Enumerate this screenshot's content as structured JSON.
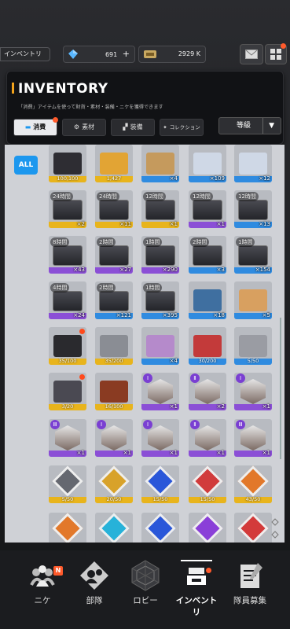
{
  "header": {
    "section_tag": "インベントリ",
    "gems": "691",
    "gems_plus": "+",
    "credits": "2929 K"
  },
  "panel": {
    "title": "INVENTORY",
    "subtitle": "「消費」アイテムを使って財貨・素材・装備・ニケを獲得できます",
    "tabs": [
      {
        "label": "消費",
        "icon": "consumable-icon"
      },
      {
        "label": "素材",
        "icon": "material-icon"
      },
      {
        "label": "装備",
        "icon": "equipment-icon"
      },
      {
        "label": "コレクション",
        "icon": "collection-icon"
      }
    ],
    "sort_label": "等級",
    "sort_arrow": "▼"
  },
  "filter": {
    "all_label": "ALL"
  },
  "colors": {
    "accent": "#f3a31c",
    "blue": "#1c97ee",
    "ssr": "#e8b41c",
    "sr": "#8b4fd6",
    "r": "#2f8be0"
  },
  "items": [
    {
      "label": "",
      "count": "100,100",
      "rarity": "ssr",
      "art": "dark-box",
      "row": 0,
      "col": 0
    },
    {
      "label": "",
      "count": "1,427",
      "rarity": "ssr",
      "art": "gold-box",
      "row": 0,
      "col": 1
    },
    {
      "label": "",
      "count": "4",
      "rarity": "r",
      "art": "cardboard-box",
      "row": 0,
      "col": 2
    },
    {
      "label": "",
      "count": "109",
      "rarity": "r",
      "art": "silver-box",
      "row": 0,
      "col": 4
    },
    {
      "label": "",
      "count": "12",
      "rarity": "r",
      "art": "silver-box",
      "row": 0,
      "col": 5
    },
    {
      "label": "24時間",
      "count": "2",
      "rarity": "ssr",
      "art": "crate",
      "row": 1,
      "col": 0
    },
    {
      "label": "24時間",
      "count": "11",
      "rarity": "ssr",
      "art": "crate",
      "row": 1,
      "col": 1
    },
    {
      "label": "12時間",
      "count": "1",
      "rarity": "ssr",
      "art": "crate",
      "row": 1,
      "col": 2
    },
    {
      "label": "12時間",
      "count": "1",
      "rarity": "sr",
      "art": "crate",
      "row": 1,
      "col": 4
    },
    {
      "label": "12時間",
      "count": "13",
      "rarity": "r",
      "art": "crate",
      "row": 1,
      "col": 5
    },
    {
      "label": "8時間",
      "count": "43",
      "rarity": "sr",
      "art": "crate",
      "row": 2,
      "col": 0
    },
    {
      "label": "2時間",
      "count": "27",
      "rarity": "sr",
      "art": "crate",
      "row": 2,
      "col": 1
    },
    {
      "label": "1時間",
      "count": "290",
      "rarity": "sr",
      "art": "crate",
      "row": 2,
      "col": 2
    },
    {
      "label": "2時間",
      "count": "3",
      "rarity": "r",
      "art": "crate",
      "row": 2,
      "col": 4
    },
    {
      "label": "1時間",
      "count": "154",
      "rarity": "r",
      "art": "crate",
      "row": 2,
      "col": 5
    },
    {
      "label": "4時間",
      "count": "24",
      "rarity": "sr",
      "art": "crate",
      "row": 3,
      "col": 0
    },
    {
      "label": "2時間",
      "count": "121",
      "rarity": "r",
      "art": "crate",
      "row": 3,
      "col": 1
    },
    {
      "label": "1時間",
      "count": "395",
      "rarity": "r",
      "art": "crate",
      "row": 3,
      "col": 2
    },
    {
      "label": "",
      "count": "18",
      "rarity": "r",
      "art": "supply-box",
      "row": 3,
      "col": 4
    },
    {
      "label": "",
      "count": "5",
      "rarity": "r",
      "art": "toy-box",
      "row": 3,
      "col": 5
    },
    {
      "label": "",
      "count": "35/100",
      "rarity": "ssr",
      "art": "black-case",
      "row": 4,
      "col": 0,
      "dot": true
    },
    {
      "label": "",
      "count": "35/200",
      "rarity": "ssr",
      "art": "steel-cube",
      "row": 4,
      "col": 1
    },
    {
      "label": "",
      "count": "4",
      "rarity": "r",
      "art": "gift-box",
      "row": 4,
      "col": 2
    },
    {
      "label": "",
      "count": "30/200",
      "rarity": "r",
      "art": "red-box",
      "row": 4,
      "col": 4
    },
    {
      "label": "",
      "count": "5/50",
      "rarity": "r",
      "art": "crates-pile",
      "row": 4,
      "col": 5
    },
    {
      "label": "",
      "count": "3/20",
      "rarity": "ssr",
      "art": "notebook",
      "row": 5,
      "col": 0,
      "dot": true
    },
    {
      "label": "",
      "count": "16/100",
      "rarity": "ssr",
      "art": "rock-core",
      "row": 5,
      "col": 1
    },
    {
      "label": "",
      "count": "1",
      "rarity": "sr",
      "art": "nikke-portrait",
      "row": 5,
      "col": 2,
      "tag": "Ⅰ"
    },
    {
      "label": "",
      "count": "2",
      "rarity": "sr",
      "art": "nikke-portrait",
      "row": 5,
      "col": 4,
      "tag": "Ⅱ"
    },
    {
      "label": "",
      "count": "1",
      "rarity": "sr",
      "art": "nikke-portrait",
      "row": 5,
      "col": 5,
      "tag": "Ⅰ"
    },
    {
      "label": "",
      "count": "1",
      "rarity": "sr",
      "art": "nikke-portrait",
      "row": 6,
      "col": 0,
      "tag": "Ⅲ"
    },
    {
      "label": "",
      "count": "1",
      "rarity": "sr",
      "art": "nikke-portrait",
      "row": 6,
      "col": 1,
      "tag": "Ⅰ"
    },
    {
      "label": "",
      "count": "1",
      "rarity": "sr",
      "art": "nikke-portrait",
      "row": 6,
      "col": 2,
      "tag": "Ⅰ"
    },
    {
      "label": "",
      "count": "1",
      "rarity": "sr",
      "art": "nikke-portrait",
      "row": 6,
      "col": 4,
      "tag": "Ⅱ"
    },
    {
      "label": "",
      "count": "1",
      "rarity": "sr",
      "art": "nikke-portrait",
      "row": 6,
      "col": 5,
      "tag": "Ⅲ"
    },
    {
      "label": "",
      "count": "5/50",
      "rarity": "ssr",
      "art": "chip-gray",
      "row": 7,
      "col": 0
    },
    {
      "label": "",
      "count": "20/50",
      "rarity": "ssr",
      "art": "chip-gold",
      "row": 7,
      "col": 1
    },
    {
      "label": "",
      "count": "15/50",
      "rarity": "ssr",
      "art": "chip-blue",
      "row": 7,
      "col": 2
    },
    {
      "label": "",
      "count": "15/50",
      "rarity": "ssr",
      "art": "chip-red",
      "row": 7,
      "col": 4
    },
    {
      "label": "",
      "count": "43/50",
      "rarity": "ssr",
      "art": "chip-orange",
      "row": 7,
      "col": 5
    },
    {
      "label": "",
      "count": "",
      "rarity": "ssr",
      "art": "chip-orange",
      "row": 8,
      "col": 0
    },
    {
      "label": "",
      "count": "",
      "rarity": "ssr",
      "art": "chip-cyan",
      "row": 8,
      "col": 1
    },
    {
      "label": "",
      "count": "",
      "rarity": "ssr",
      "art": "chip-blue",
      "row": 8,
      "col": 2
    },
    {
      "label": "",
      "count": "",
      "rarity": "ssr",
      "art": "chip-purple",
      "row": 8,
      "col": 4
    },
    {
      "label": "",
      "count": "",
      "rarity": "ssr",
      "art": "chip-red-white",
      "row": 8,
      "col": 5
    }
  ],
  "nav": [
    {
      "label": "ニケ",
      "badge": "N"
    },
    {
      "label": "部隊"
    },
    {
      "label": "ロビー"
    },
    {
      "label": "インベントリ",
      "active": true
    },
    {
      "label": "隊員募集"
    }
  ]
}
